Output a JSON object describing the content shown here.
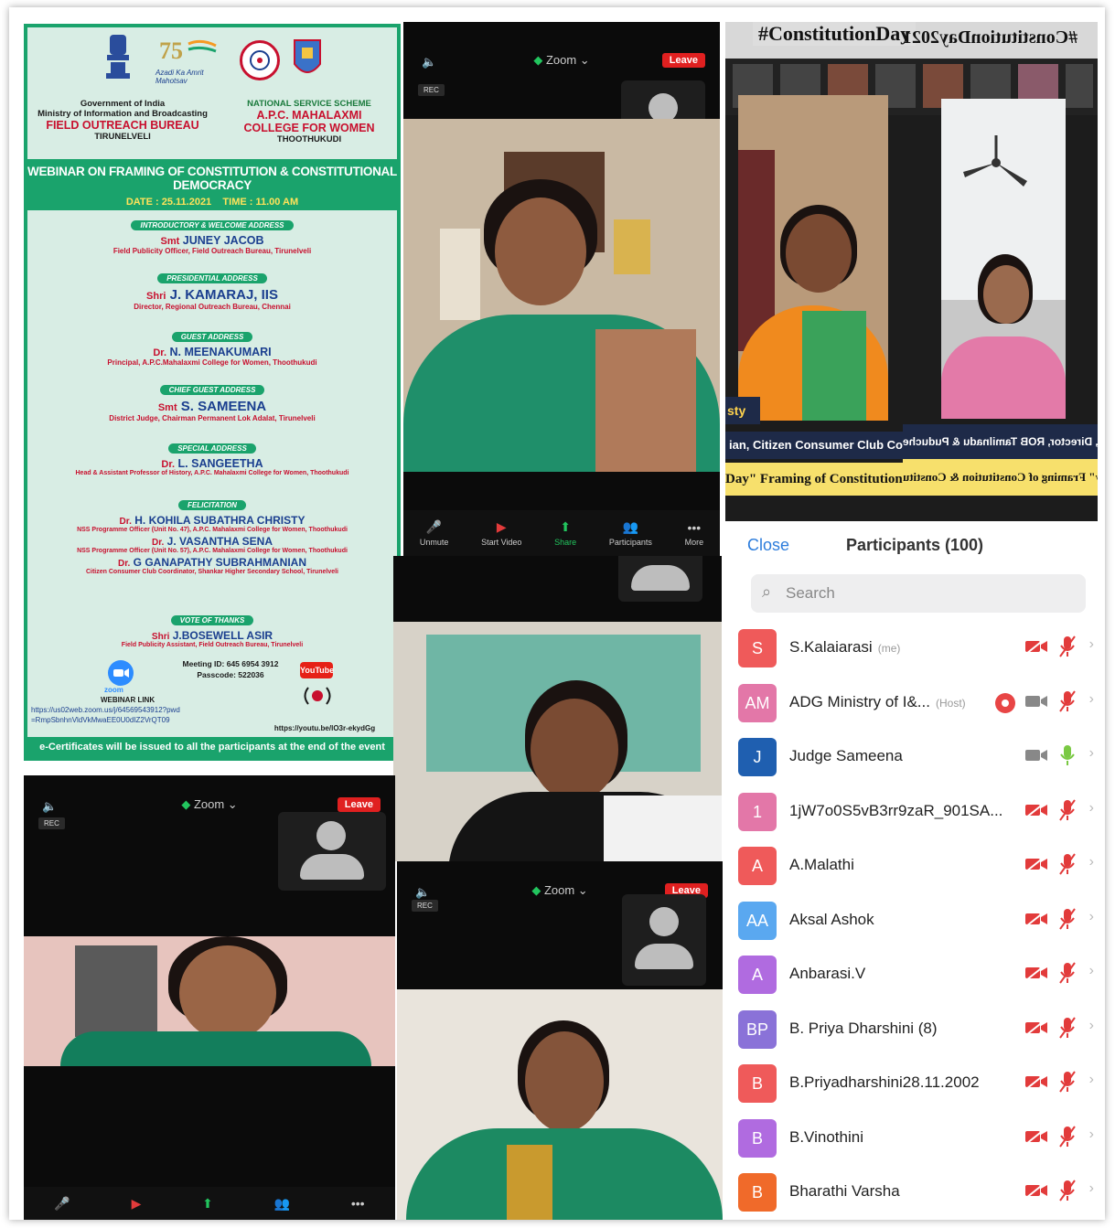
{
  "poster": {
    "gov_line1": "Government of India",
    "gov_line2": "Ministry of Information and Broadcasting",
    "gov_line3": "FIELD OUTREACH BUREAU",
    "gov_line4": "TIRUNELVELI",
    "azadi": "Azadi Ka Amrit Mahotsav",
    "nss_line1": "NATIONAL SERVICE SCHEME",
    "nss_line2": "A.P.C. MAHALAXMI",
    "nss_line3": "COLLEGE FOR WOMEN",
    "nss_line4": "THOOTHUKUDI",
    "banner_title": "WEBINAR ON FRAMING OF CONSTITUTION & CONSTITUTIONAL DEMOCRACY",
    "date": "DATE : 25.11.2021",
    "time": "TIME : 11.00 AM",
    "sections": [
      {
        "pill": "INTRODUCTORY & WELCOME ADDRESS",
        "prefix": "Smt",
        "name": "JUNEY JACOB",
        "desc": "Field Publicity Officer, Field Outreach Bureau, Tirunelveli"
      },
      {
        "pill": "PRESIDENTIAL ADDRESS",
        "prefix": "Shri",
        "name": "J. KAMARAJ, IIS",
        "desc": "Director, Regional Outreach Bureau, Chennai"
      },
      {
        "pill": "GUEST ADDRESS",
        "prefix": "Dr.",
        "name": "N. MEENAKUMARI",
        "desc": "Principal, A.P.C.Mahalaxmi College for Women, Thoothukudi"
      },
      {
        "pill": "CHIEF GUEST ADDRESS",
        "prefix": "Smt",
        "name": "S. SAMEENA",
        "desc": "District Judge, Chairman Permanent Lok Adalat, Tirunelveli"
      },
      {
        "pill": "SPECIAL ADDRESS",
        "prefix": "Dr.",
        "name": "L. SANGEETHA",
        "desc": "Head & Assistant Professor of History, A.P.C. Mahalaxmi College for Women, Thoothukudi"
      }
    ],
    "felicitation_pill": "FELICITATION",
    "felicitation": [
      {
        "prefix": "Dr.",
        "name": "H. KOHILA SUBATHRA CHRISTY",
        "desc": "NSS Programme Officer (Unit No. 47), A.P.C. Mahalaxmi College for Women, Thoothukudi"
      },
      {
        "prefix": "Dr.",
        "name": "J. VASANTHA SENA",
        "desc": "NSS Programme Officer (Unit No. 57), A.P.C. Mahalaxmi College for Women, Thoothukudi"
      },
      {
        "prefix": "Dr.",
        "name": "G GANAPATHY SUBRAHMANIAN",
        "desc": "Citizen Consumer Club Coordinator, Shankar Higher Secondary School, Tirunelveli"
      }
    ],
    "vote_pill": "VOTE OF THANKS",
    "vote": {
      "prefix": "Shri",
      "name": "J.BOSEWELL ASIR",
      "desc": "Field Publicity Assistant, Field Outreach Bureau, Tirunelveli"
    },
    "meeting_id": "Meeting ID: 645 6954 3912",
    "passcode": "Passcode: 522036",
    "webinar_link_label": "WEBINAR LINK",
    "webinar_link": "https://us02web.zoom.us/j/64569543912?pwd =RmpSbnhnVldVkMwaEE0U0dIZ2VrQT09",
    "zoom_label": "zoom",
    "youtube_label": "YouTube",
    "youtube_link": "https://youtu.be/lO3r-ekydGg",
    "certificate": "e-Certificates will be issued to all the participants at the end of the event"
  },
  "zoom": {
    "app_label": "Zoom",
    "leave": "Leave",
    "rec": "REC",
    "toolbar": [
      {
        "icon": "unmute-icon",
        "label": "Unmute"
      },
      {
        "icon": "start-video-icon",
        "label": "Start Video"
      },
      {
        "icon": "share-icon",
        "label": "Share"
      },
      {
        "icon": "participants-icon",
        "label": "Participants",
        "count": "100"
      },
      {
        "icon": "more-icon",
        "label": "More"
      }
    ]
  },
  "broadcast": {
    "hashtag": "#ConstitutionDay",
    "hashtag_mirrored": "#ConstitutionDay2021",
    "corner_text": "sty",
    "ticker_top_left": "ian, Citizen Consumer Club Coor",
    "ticker_top_right": "rai, I.I.S., Director, ROB Tamilnadu & Puduche",
    "ticker_bottom_left": "Day\" Framing of Constitution & C",
    "ticker_bottom_right": "nstitution Day\" Framing of Constitution & Constitu"
  },
  "participants": {
    "close": "Close",
    "title": "Participants (100)",
    "search_placeholder": "Search",
    "list": [
      {
        "initials": "S",
        "name": "S.Kalaiarasi",
        "tag": "(me)",
        "color": "#ef5a5a",
        "video": "off",
        "mic": "muted"
      },
      {
        "initials": "AM",
        "name": "ADG Ministry of I&...",
        "tag": "(Host)",
        "color": "#e377a8",
        "video": "on",
        "mic": "muted",
        "recording": true
      },
      {
        "initials": "J",
        "name": "Judge Sameena",
        "tag": "",
        "color": "#1f5fb0",
        "video": "on",
        "mic": "active"
      },
      {
        "initials": "1",
        "name": "1jW7o0S5vB3rr9zaR_901SA...",
        "tag": "",
        "color": "#e377a8",
        "video": "off",
        "mic": "muted"
      },
      {
        "initials": "A",
        "name": "A.Malathi",
        "tag": "",
        "color": "#ef5a5a",
        "video": "off",
        "mic": "muted"
      },
      {
        "initials": "AA",
        "name": "Aksal Ashok",
        "tag": "",
        "color": "#5aa8f0",
        "video": "off",
        "mic": "muted"
      },
      {
        "initials": "A",
        "name": "Anbarasi.V",
        "tag": "",
        "color": "#b06be0",
        "video": "off",
        "mic": "muted"
      },
      {
        "initials": "BP",
        "name": "B. Priya Dharshini (8)",
        "tag": "",
        "color": "#8a72d8",
        "video": "off",
        "mic": "muted"
      },
      {
        "initials": "B",
        "name": "B.Priyadharshini28.11.2002",
        "tag": "",
        "color": "#ef5a5a",
        "video": "off",
        "mic": "muted"
      },
      {
        "initials": "B",
        "name": "B.Vinothini",
        "tag": "",
        "color": "#b06be0",
        "video": "off",
        "mic": "muted"
      },
      {
        "initials": "B",
        "name": "Bharathi Varsha",
        "tag": "",
        "color": "#f06a2a",
        "video": "off",
        "mic": "muted"
      }
    ]
  },
  "colors": {
    "poster_green": "#1aa36c",
    "poster_bg": "#d8ede4",
    "zoom_blue": "#2d7ddc",
    "leave_red": "#e02020",
    "mute_red": "#e23b3b"
  }
}
